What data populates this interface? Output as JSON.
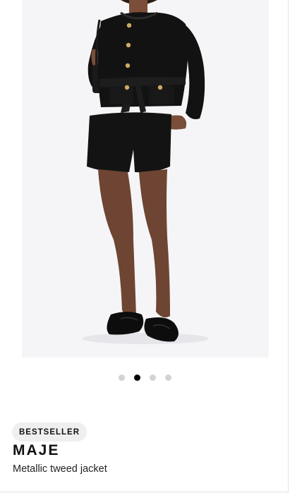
{
  "product": {
    "badge": "BESTSELLER",
    "brand": "MAJE",
    "name": "Metallic tweed jacket"
  },
  "gallery": {
    "image_alt": "Model wearing black metallic tweed jacket with gold buttons and matching shorts",
    "image_count": 4,
    "active_index": 1
  },
  "colors": {
    "background": "#ffffff",
    "image_background": "#f5f5f7",
    "dot_inactive": "#d3d3d3",
    "dot_active": "#000000",
    "badge_background": "#efefef"
  }
}
